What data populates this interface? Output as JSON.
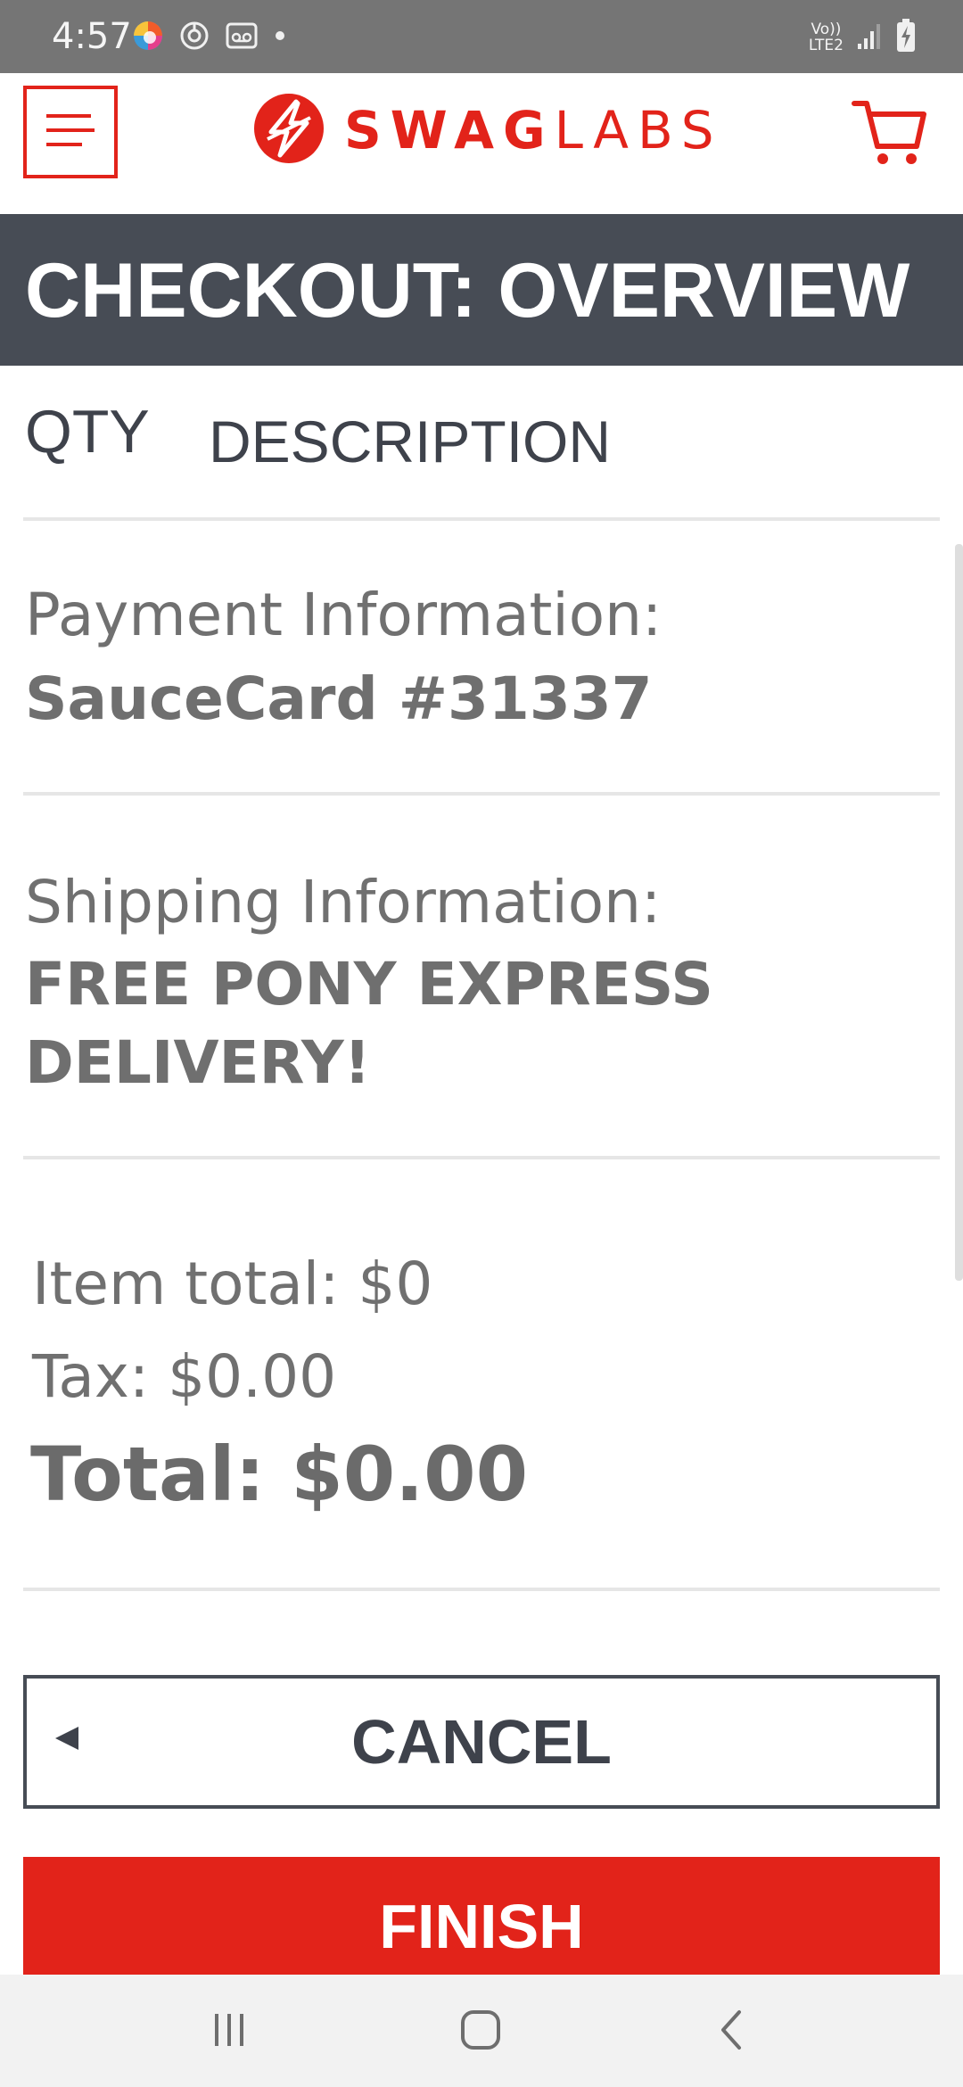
{
  "status_bar": {
    "time": "4:57",
    "network_label_top": "Vo))",
    "network_label_bottom": "LTE2"
  },
  "header": {
    "brand_bold": "SWAG",
    "brand_light": "LABS",
    "brand_color": "#e2231a"
  },
  "page": {
    "title": "CHECKOUT: OVERVIEW",
    "title_bar_color": "#474c55"
  },
  "cart_list": {
    "qty_header": "QTY",
    "description_header": "DESCRIPTION"
  },
  "summary": {
    "payment_label": "Payment Information:",
    "payment_value": "SauceCard #31337",
    "shipping_label": "Shipping Information:",
    "shipping_value_line1": "FREE PONY EXPRESS",
    "shipping_value_line2": "DELIVERY!",
    "item_total": "Item total: $0",
    "tax": "Tax: $0.00",
    "total": "Total: $0.00"
  },
  "actions": {
    "cancel_label": "CANCEL",
    "finish_label": "FINISH"
  },
  "icons": {
    "menu": "hamburger-menu-icon",
    "cart": "cart-icon",
    "logo": "swag-labs-logo-icon",
    "nav_recent": "recent-apps-icon",
    "nav_home": "home-icon",
    "nav_back": "back-icon"
  }
}
